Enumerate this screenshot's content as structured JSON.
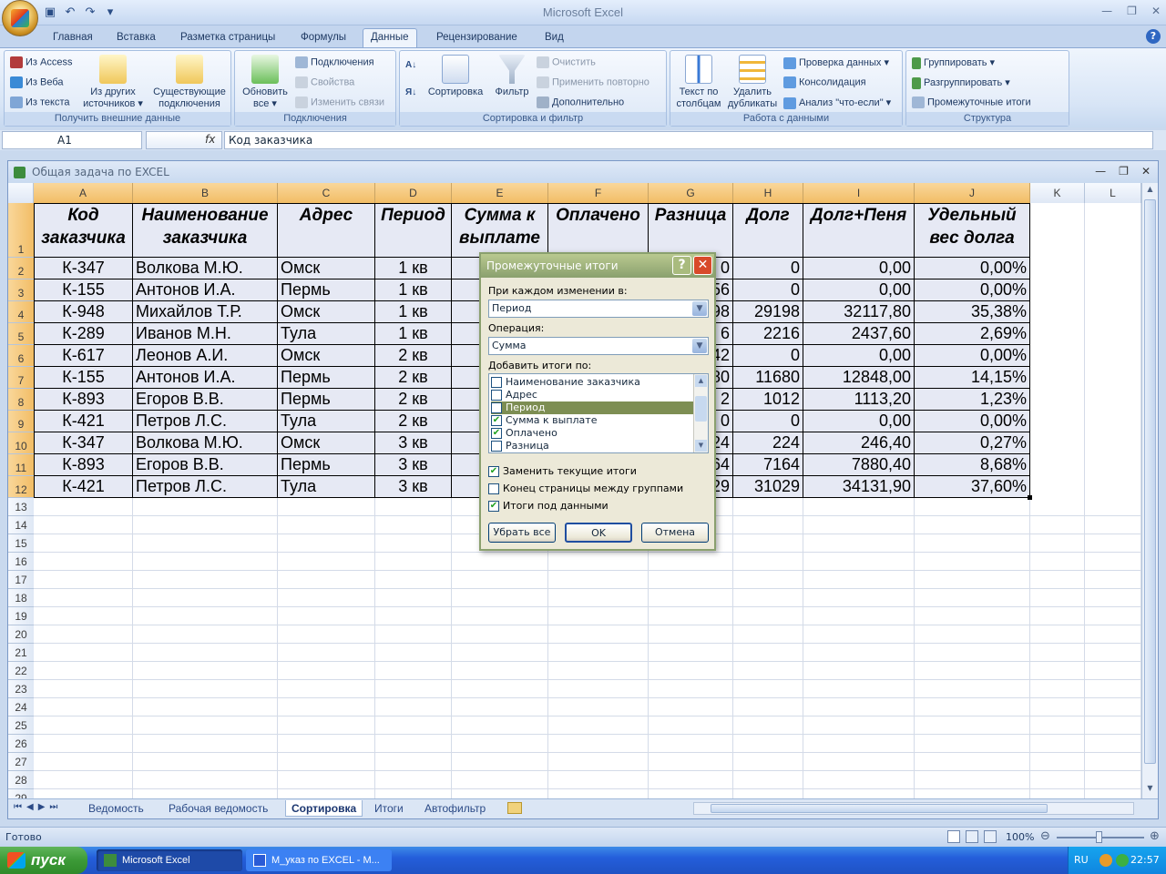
{
  "app": {
    "title": "Microsoft Excel"
  },
  "tabs": [
    "Главная",
    "Вставка",
    "Разметка страницы",
    "Формулы",
    "Данные",
    "Рецензирование",
    "Вид"
  ],
  "ribbon": {
    "get_external": {
      "label": "Получить внешние данные",
      "from_access": "Из Access",
      "from_web": "Из Веба",
      "from_text": "Из текста",
      "from_other": [
        "Из других",
        "источников ▾"
      ],
      "existing": [
        "Существующие",
        "подключения"
      ]
    },
    "connections": {
      "label": "Подключения",
      "refresh": [
        "Обновить",
        "все ▾"
      ],
      "conn": "Подключения",
      "props": "Свойства",
      "edit_links": "Изменить связи"
    },
    "sort_filter": {
      "label": "Сортировка и фильтр",
      "sort": "Сортировка",
      "filter": "Фильтр",
      "clear": "Очистить",
      "reapply": "Применить повторно",
      "advanced": "Дополнительно"
    },
    "data_tools": {
      "label": "Работа с данными",
      "text_to_cols": [
        "Текст по",
        "столбцам"
      ],
      "remove_dup": [
        "Удалить",
        "дубликаты"
      ],
      "validation": "Проверка данных ▾",
      "consolidate": "Консолидация",
      "whatif": "Анализ \"что-если\" ▾"
    },
    "outline": {
      "label": "Структура",
      "group": "Группировать ▾",
      "ungroup": "Разгруппировать ▾",
      "subtotal": "Промежуточные итоги"
    }
  },
  "formula_bar": {
    "name_box": "A1",
    "fx": "fx",
    "content": "Код заказчика"
  },
  "workbook": {
    "title": "Общая задача по EXCEL"
  },
  "columns": [
    "A",
    "B",
    "C",
    "D",
    "E",
    "F",
    "G",
    "H",
    "I",
    "J",
    "K",
    "L"
  ],
  "header_cells": [
    "Код заказчика",
    "Наименование заказчика",
    "Адрес",
    "Период",
    "Сумма к выплате",
    "Оплачено",
    "Разница",
    "Долг",
    "Долг+Пеня",
    "Удельный вес долга"
  ],
  "rows": [
    {
      "n": "2",
      "a": "К-347",
      "b": "Волкова М.Ю.",
      "c": "Омск",
      "d": "1 кв",
      "g": "0",
      "h": "0",
      "i": "0,00",
      "j": "0,00%"
    },
    {
      "n": "3",
      "a": "К-155",
      "b": "Антонов И.А.",
      "c": "Пермь",
      "d": "1 кв",
      "g": "56",
      "h": "0",
      "i": "0,00",
      "j": "0,00%"
    },
    {
      "n": "4",
      "a": "К-948",
      "b": "Михайлов Т.Р.",
      "c": "Омск",
      "d": "1 кв",
      "g": "98",
      "h": "29198",
      "i": "32117,80",
      "j": "35,38%"
    },
    {
      "n": "5",
      "a": "К-289",
      "b": "Иванов М.Н.",
      "c": "Тула",
      "d": "1 кв",
      "g": "6",
      "h": "2216",
      "i": "2437,60",
      "j": "2,69%"
    },
    {
      "n": "6",
      "a": "К-617",
      "b": "Леонов А.И.",
      "c": "Омск",
      "d": "2 кв",
      "g": "42",
      "h": "0",
      "i": "0,00",
      "j": "0,00%"
    },
    {
      "n": "7",
      "a": "К-155",
      "b": "Антонов И.А.",
      "c": "Пермь",
      "d": "2 кв",
      "g": "80",
      "h": "11680",
      "i": "12848,00",
      "j": "14,15%"
    },
    {
      "n": "8",
      "a": "К-893",
      "b": "Егоров В.В.",
      "c": "Пермь",
      "d": "2 кв",
      "g": "2",
      "h": "1012",
      "i": "1113,20",
      "j": "1,23%"
    },
    {
      "n": "9",
      "a": "К-421",
      "b": "Петров Л.С.",
      "c": "Тула",
      "d": "2 кв",
      "g": "0",
      "h": "0",
      "i": "0,00",
      "j": "0,00%"
    },
    {
      "n": "10",
      "a": "К-347",
      "b": "Волкова М.Ю.",
      "c": "Омск",
      "d": "3 кв",
      "g": "24",
      "h": "224",
      "i": "246,40",
      "j": "0,27%"
    },
    {
      "n": "11",
      "a": "К-893",
      "b": "Егоров В.В.",
      "c": "Пермь",
      "d": "3 кв",
      "g": "64",
      "h": "7164",
      "i": "7880,40",
      "j": "8,68%"
    },
    {
      "n": "12",
      "a": "К-421",
      "b": "Петров Л.С.",
      "c": "Тула",
      "d": "3 кв",
      "g": "29",
      "h": "31029",
      "i": "34131,90",
      "j": "37,60%"
    }
  ],
  "empty_rows": [
    "13",
    "14",
    "15",
    "16",
    "17",
    "18",
    "19",
    "20",
    "21",
    "22",
    "23",
    "24",
    "25",
    "26",
    "27",
    "28",
    "29"
  ],
  "sheets": [
    "Ведомость",
    "Рабочая ведомость",
    "Сортировка",
    "Итоги",
    "Автофильтр"
  ],
  "active_sheet": "Сортировка",
  "status": {
    "ready": "Готово",
    "zoom": "100%"
  },
  "taskbar": {
    "start": "пуск",
    "tasks": [
      "Microsoft Excel",
      "М_указ по EXCEL - М..."
    ],
    "lang": "RU",
    "time": "22:57"
  },
  "dialog": {
    "title": "Промежуточные итоги",
    "at_each_change_label": "При каждом изменении в:",
    "at_each_change_value": "Период",
    "function_label": "Операция:",
    "function_value": "Сумма",
    "add_to_label": "Добавить итоги по:",
    "list": [
      {
        "label": "Наименование заказчика",
        "checked": false
      },
      {
        "label": "Адрес",
        "checked": false
      },
      {
        "label": "Период",
        "checked": false
      },
      {
        "label": "Сумма к выплате",
        "checked": true
      },
      {
        "label": "Оплачено",
        "checked": true
      },
      {
        "label": "Разница",
        "checked": false
      }
    ],
    "replace": "Заменить текущие итоги",
    "page_break": "Конец страницы между группами",
    "summary_below": "Итоги под данными",
    "replace_checked": true,
    "page_break_checked": false,
    "summary_below_checked": true,
    "remove_all": "Убрать все",
    "ok": "OK",
    "cancel": "Отмена"
  }
}
